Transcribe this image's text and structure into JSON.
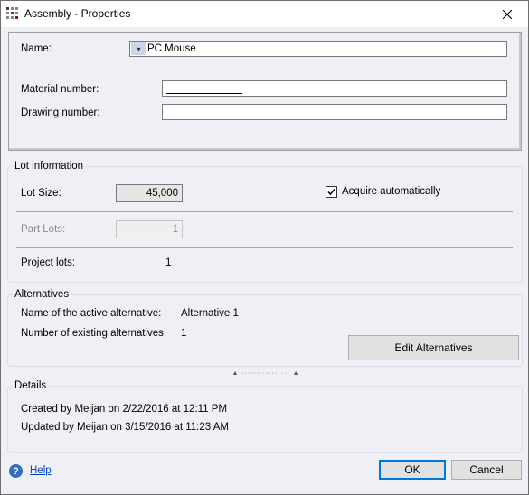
{
  "window": {
    "title": "Assembly - Properties"
  },
  "general": {
    "name_label": "Name:",
    "name_value": "PC Mouse",
    "material_label": "Material number:",
    "drawing_label": "Drawing number:"
  },
  "lot": {
    "title": "Lot information",
    "lot_size_label": "Lot Size:",
    "lot_size_value": "45,000",
    "acquire_label": "Acquire automatically",
    "acquire_checked": true,
    "part_lots_label": "Part Lots:",
    "part_lots_value": "1",
    "project_lots_label": "Project lots:",
    "project_lots_value": "1"
  },
  "alternatives": {
    "title": "Alternatives",
    "active_label": "Name of the active alternative:",
    "active_value": "Alternative 1",
    "count_label": "Number of existing alternatives:",
    "count_value": "1",
    "edit_button": "Edit Alternatives"
  },
  "details": {
    "title": "Details",
    "created": "Created by Meijan on 2/22/2016 at 12:11 PM",
    "updated": "Updated by Meijan on 3/15/2016 at 11:23 AM"
  },
  "footer": {
    "help_label": "Help",
    "ok_label": "OK",
    "cancel_label": "Cancel"
  },
  "icons": {
    "app": "grid-icon",
    "close": "close-icon",
    "dropdown": "chevron-down-icon",
    "checkbox": "checkmark-icon",
    "help": "help-icon"
  },
  "colors": {
    "accent": "#0078d7",
    "help_link": "#0044cc",
    "help_icon_bg": "#2e6fc0",
    "dialog_bg": "#eef0f5"
  }
}
